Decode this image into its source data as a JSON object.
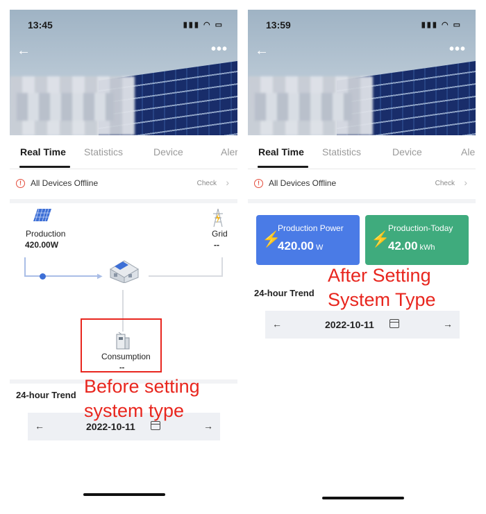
{
  "screens": {
    "left": {
      "status_time": "13:45",
      "tabs": [
        "Real Time",
        "Statistics",
        "Device",
        "Aler"
      ],
      "alert": {
        "text": "All Devices Offline",
        "action": "Check"
      },
      "flow": {
        "production_label": "Production",
        "production_value": "420.00W",
        "grid_label": "Grid",
        "grid_value": "--",
        "consumption_label": "Consumption",
        "consumption_value": "--"
      },
      "trend_title": "24-hour Trend",
      "date": "2022-10-11",
      "annotation": [
        "Before setting",
        "system type"
      ]
    },
    "right": {
      "status_time": "13:59",
      "tabs": [
        "Real Time",
        "Statistics",
        "Device",
        "Aler"
      ],
      "alert": {
        "text": "All Devices Offline",
        "action": "Check"
      },
      "cards": [
        {
          "title": "Production Power",
          "value": "420.00",
          "unit": "W",
          "color": "#4a7be6"
        },
        {
          "title": "Production-Today",
          "value": "42.00",
          "unit": "kWh",
          "color": "#3fab7d"
        }
      ],
      "trend_title": "24-hour Trend",
      "date": "2022-10-11",
      "annotation": [
        "After Setting",
        "System Type"
      ]
    }
  },
  "colors": {
    "accent_red": "#e8261e",
    "alert_red": "#e34b3a",
    "card_blue": "#4a7be6",
    "card_green": "#3fab7d"
  },
  "icons": [
    "location-arrow-icon",
    "signal-icon",
    "wifi-icon",
    "battery-icon",
    "back-arrow-icon",
    "more-icon",
    "alert-circle-icon",
    "chevron-right-icon",
    "solar-panel-icon",
    "power-tower-icon",
    "house-icon",
    "battery-storage-icon",
    "lightning-bolt-icon",
    "calendar-icon"
  ]
}
